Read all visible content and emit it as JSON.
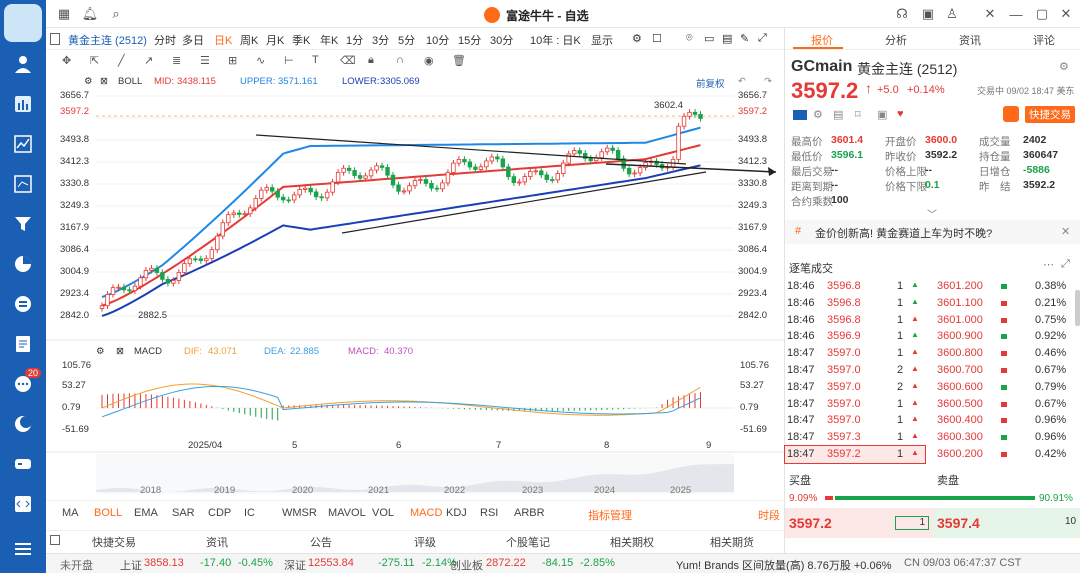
{
  "window": {
    "title": "富途牛牛 - 自选"
  },
  "sidebar": {
    "badge": "20"
  },
  "symbol_tab": {
    "name": "黄金主连 (2512)"
  },
  "toolbar": {
    "periods": [
      "分时",
      "多日",
      "日K",
      "周K",
      "月K",
      "季K",
      "年K",
      "1分",
      "3分",
      "5分",
      "10分",
      "15分",
      "30分"
    ],
    "active_period": "日K",
    "range": "10年 : 日K",
    "display": "显示"
  },
  "boll": {
    "label": "BOLL",
    "mid_label": "MID:",
    "mid": "3438.115",
    "upper_label": "UPPER:",
    "upper": "3571.161",
    "lower_label": "LOWER:",
    "lower": "3305.069",
    "adjust": "前复权"
  },
  "price_axis": [
    "3656.7",
    "3597.2",
    "3493.8",
    "3412.3",
    "3330.8",
    "3249.3",
    "3167.9",
    "3086.4",
    "3004.9",
    "2923.4",
    "2842.0"
  ],
  "price_axis_right": [
    "3656.7",
    "3597.2",
    "3493.8",
    "3412.3",
    "3330.8",
    "3249.3",
    "3167.9",
    "3086.4",
    "3004.9",
    "2923.4",
    "2842.0"
  ],
  "annotations": {
    "high": "3602.4",
    "low": "2882.5"
  },
  "macd": {
    "label": "MACD",
    "dif_label": "DIF:",
    "dif": "43.071",
    "dea_label": "DEA:",
    "dea": "22.885",
    "macd_label": "MACD:",
    "macd": "40.370",
    "axis": [
      "105.76",
      "53.27",
      "0.79",
      "-51.69"
    ]
  },
  "date_axis": [
    "2025/04",
    "5",
    "6",
    "7",
    "8",
    "9"
  ],
  "year_axis": [
    "2018",
    "2019",
    "2020",
    "2021",
    "2022",
    "2023",
    "2024",
    "2025"
  ],
  "indicators": [
    "MA",
    "BOLL",
    "EMA",
    "SAR",
    "CDP",
    "IC",
    "WMSR",
    "MAVOL",
    "VOL",
    "MACD",
    "KDJ",
    "RSI",
    "ARBR"
  ],
  "indicator_mgmt": "指标管理",
  "time_label": "时段",
  "bottom_nav": [
    "快捷交易",
    "资讯",
    "公告",
    "评级",
    "个股笔记",
    "相关期权",
    "相关期货"
  ],
  "ticker": {
    "status": "未开盘",
    "items": [
      {
        "name": "上证",
        "value": "3858.13",
        "chg": "-17.40",
        "pct": "-0.45%"
      },
      {
        "name": "深证",
        "value": "12553.84",
        "chg": "-275.11",
        "pct": "-2.14%"
      },
      {
        "name": "创业板",
        "value": "2872.22",
        "chg": "-84.15",
        "pct": "-2.85%"
      }
    ],
    "news": "Yum! Brands 区间放量(高) 8.76万股 +0.06%",
    "time": "CN 09/03 06:47:37 CST"
  },
  "right": {
    "tabs": [
      "报价",
      "分析",
      "资讯",
      "评论"
    ],
    "code": "GCmain",
    "name": "黄金主连 (2512)",
    "price": "3597.2",
    "change": "+5.0",
    "pct": "+0.14%",
    "session": "交易中 09/02 18:47 美东",
    "quick_trade": "快捷交易",
    "stats": [
      [
        "最高价",
        "3601.4",
        "开盘价",
        "3600.0",
        "成交量",
        "2402"
      ],
      [
        "最低价",
        "3596.1",
        "昨收价",
        "3592.2",
        "持仓量",
        "360647"
      ],
      [
        "最后交易",
        "--",
        "价格上限",
        "--",
        "日增仓",
        "-5886"
      ],
      [
        "距离到期",
        "--",
        "价格下限",
        "0.1",
        "昨　结",
        "3592.2"
      ],
      [
        "合约乘数",
        "100",
        "",
        "",
        "",
        ""
      ]
    ],
    "news": "金价创新高! 黄金赛道上车为时不晚?",
    "trades_title": "逐笔成交",
    "trades": [
      [
        "18:46",
        "3596.8",
        "1",
        "3601.200",
        "0.38%"
      ],
      [
        "18:46",
        "3596.8",
        "1",
        "3601.100",
        "0.21%"
      ],
      [
        "18:46",
        "3596.8",
        "1",
        "3601.000",
        "0.75%"
      ],
      [
        "18:46",
        "3596.9",
        "1",
        "3600.900",
        "0.92%"
      ],
      [
        "18:47",
        "3597.0",
        "1",
        "3600.800",
        "0.46%"
      ],
      [
        "18:47",
        "3597.0",
        "2",
        "3600.700",
        "0.67%"
      ],
      [
        "18:47",
        "3597.0",
        "2",
        "3600.600",
        "0.79%"
      ],
      [
        "18:47",
        "3597.0",
        "1",
        "3600.500",
        "0.67%"
      ],
      [
        "18:47",
        "3597.0",
        "1",
        "3600.400",
        "0.96%"
      ],
      [
        "18:47",
        "3597.3",
        "1",
        "3600.300",
        "0.96%"
      ],
      [
        "18:47",
        "3597.2",
        "1",
        "3600.200",
        "0.42%"
      ]
    ],
    "bid_label": "买盘",
    "ask_label": "卖盘",
    "bid_pct": "9.09%",
    "ask_pct": "90.91%",
    "bid": "3597.2",
    "bid_qty": "1",
    "ask": "3597.4",
    "ask_qty": "10"
  }
}
